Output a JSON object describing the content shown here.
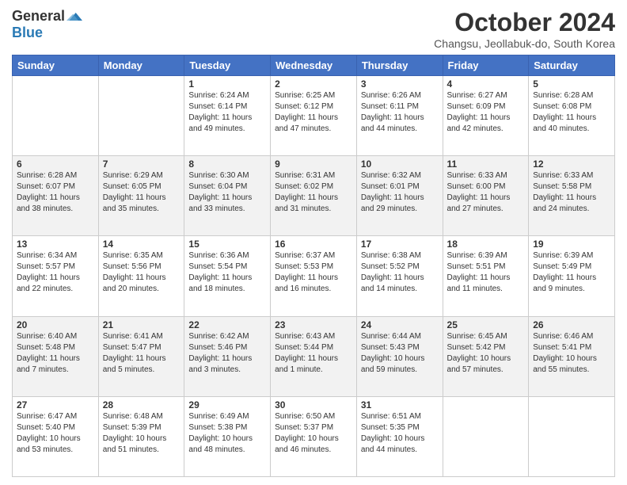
{
  "logo": {
    "general": "General",
    "blue": "Blue"
  },
  "header": {
    "month": "October 2024",
    "location": "Changsu, Jeollabuk-do, South Korea"
  },
  "weekdays": [
    "Sunday",
    "Monday",
    "Tuesday",
    "Wednesday",
    "Thursday",
    "Friday",
    "Saturday"
  ],
  "weeks": [
    [
      {
        "day": "",
        "info": ""
      },
      {
        "day": "",
        "info": ""
      },
      {
        "day": "1",
        "info": "Sunrise: 6:24 AM\nSunset: 6:14 PM\nDaylight: 11 hours and 49 minutes."
      },
      {
        "day": "2",
        "info": "Sunrise: 6:25 AM\nSunset: 6:12 PM\nDaylight: 11 hours and 47 minutes."
      },
      {
        "day": "3",
        "info": "Sunrise: 6:26 AM\nSunset: 6:11 PM\nDaylight: 11 hours and 44 minutes."
      },
      {
        "day": "4",
        "info": "Sunrise: 6:27 AM\nSunset: 6:09 PM\nDaylight: 11 hours and 42 minutes."
      },
      {
        "day": "5",
        "info": "Sunrise: 6:28 AM\nSunset: 6:08 PM\nDaylight: 11 hours and 40 minutes."
      }
    ],
    [
      {
        "day": "6",
        "info": "Sunrise: 6:28 AM\nSunset: 6:07 PM\nDaylight: 11 hours and 38 minutes."
      },
      {
        "day": "7",
        "info": "Sunrise: 6:29 AM\nSunset: 6:05 PM\nDaylight: 11 hours and 35 minutes."
      },
      {
        "day": "8",
        "info": "Sunrise: 6:30 AM\nSunset: 6:04 PM\nDaylight: 11 hours and 33 minutes."
      },
      {
        "day": "9",
        "info": "Sunrise: 6:31 AM\nSunset: 6:02 PM\nDaylight: 11 hours and 31 minutes."
      },
      {
        "day": "10",
        "info": "Sunrise: 6:32 AM\nSunset: 6:01 PM\nDaylight: 11 hours and 29 minutes."
      },
      {
        "day": "11",
        "info": "Sunrise: 6:33 AM\nSunset: 6:00 PM\nDaylight: 11 hours and 27 minutes."
      },
      {
        "day": "12",
        "info": "Sunrise: 6:33 AM\nSunset: 5:58 PM\nDaylight: 11 hours and 24 minutes."
      }
    ],
    [
      {
        "day": "13",
        "info": "Sunrise: 6:34 AM\nSunset: 5:57 PM\nDaylight: 11 hours and 22 minutes."
      },
      {
        "day": "14",
        "info": "Sunrise: 6:35 AM\nSunset: 5:56 PM\nDaylight: 11 hours and 20 minutes."
      },
      {
        "day": "15",
        "info": "Sunrise: 6:36 AM\nSunset: 5:54 PM\nDaylight: 11 hours and 18 minutes."
      },
      {
        "day": "16",
        "info": "Sunrise: 6:37 AM\nSunset: 5:53 PM\nDaylight: 11 hours and 16 minutes."
      },
      {
        "day": "17",
        "info": "Sunrise: 6:38 AM\nSunset: 5:52 PM\nDaylight: 11 hours and 14 minutes."
      },
      {
        "day": "18",
        "info": "Sunrise: 6:39 AM\nSunset: 5:51 PM\nDaylight: 11 hours and 11 minutes."
      },
      {
        "day": "19",
        "info": "Sunrise: 6:39 AM\nSunset: 5:49 PM\nDaylight: 11 hours and 9 minutes."
      }
    ],
    [
      {
        "day": "20",
        "info": "Sunrise: 6:40 AM\nSunset: 5:48 PM\nDaylight: 11 hours and 7 minutes."
      },
      {
        "day": "21",
        "info": "Sunrise: 6:41 AM\nSunset: 5:47 PM\nDaylight: 11 hours and 5 minutes."
      },
      {
        "day": "22",
        "info": "Sunrise: 6:42 AM\nSunset: 5:46 PM\nDaylight: 11 hours and 3 minutes."
      },
      {
        "day": "23",
        "info": "Sunrise: 6:43 AM\nSunset: 5:44 PM\nDaylight: 11 hours and 1 minute."
      },
      {
        "day": "24",
        "info": "Sunrise: 6:44 AM\nSunset: 5:43 PM\nDaylight: 10 hours and 59 minutes."
      },
      {
        "day": "25",
        "info": "Sunrise: 6:45 AM\nSunset: 5:42 PM\nDaylight: 10 hours and 57 minutes."
      },
      {
        "day": "26",
        "info": "Sunrise: 6:46 AM\nSunset: 5:41 PM\nDaylight: 10 hours and 55 minutes."
      }
    ],
    [
      {
        "day": "27",
        "info": "Sunrise: 6:47 AM\nSunset: 5:40 PM\nDaylight: 10 hours and 53 minutes."
      },
      {
        "day": "28",
        "info": "Sunrise: 6:48 AM\nSunset: 5:39 PM\nDaylight: 10 hours and 51 minutes."
      },
      {
        "day": "29",
        "info": "Sunrise: 6:49 AM\nSunset: 5:38 PM\nDaylight: 10 hours and 48 minutes."
      },
      {
        "day": "30",
        "info": "Sunrise: 6:50 AM\nSunset: 5:37 PM\nDaylight: 10 hours and 46 minutes."
      },
      {
        "day": "31",
        "info": "Sunrise: 6:51 AM\nSunset: 5:35 PM\nDaylight: 10 hours and 44 minutes."
      },
      {
        "day": "",
        "info": ""
      },
      {
        "day": "",
        "info": ""
      }
    ]
  ]
}
